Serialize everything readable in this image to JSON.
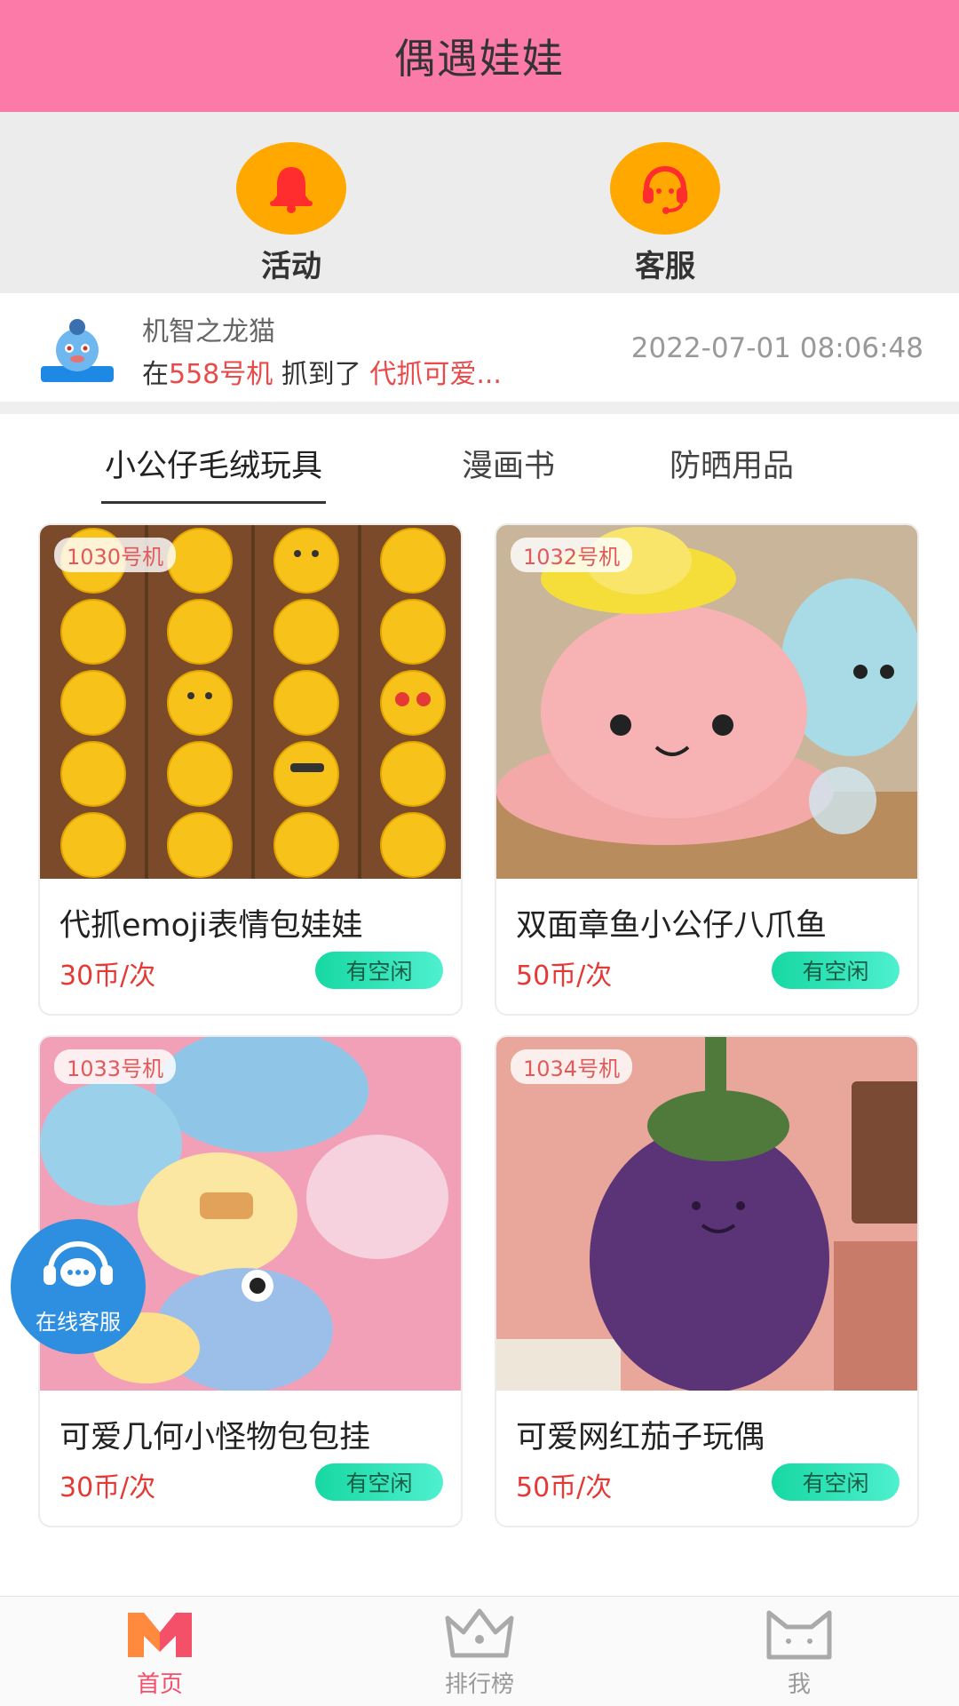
{
  "header": {
    "title": "偶遇娃娃"
  },
  "quick_actions": [
    {
      "label": "活动",
      "icon": "bell-icon"
    },
    {
      "label": "客服",
      "icon": "headset-icon"
    }
  ],
  "notice": {
    "nickname": "机智之龙猫",
    "prefix": "在",
    "machine": "558号机",
    "middle": " 抓到了 ",
    "prize": "代抓可爱...",
    "time": "2022-07-01 08:06:48"
  },
  "tabs": [
    "小公仔毛绒玩具",
    "漫画书",
    "防晒用品"
  ],
  "products": [
    {
      "tag": "1030号机",
      "name": "代抓emoji表情包娃娃",
      "price": "30币/次",
      "status": "有空闲"
    },
    {
      "tag": "1032号机",
      "name": "双面章鱼小公仔八爪鱼",
      "price": "50币/次",
      "status": "有空闲"
    },
    {
      "tag": "1033号机",
      "name": "可爱几何小怪物包包挂",
      "price": "30币/次",
      "status": "有空闲"
    },
    {
      "tag": "1034号机",
      "name": "可爱网红茄子玩偶",
      "price": "50币/次",
      "status": "有空闲"
    }
  ],
  "float_service": {
    "label": "在线客服"
  },
  "bottom_nav": [
    {
      "label": "首页",
      "active": true
    },
    {
      "label": "排行榜",
      "active": false
    },
    {
      "label": "我",
      "active": false
    }
  ],
  "colors": {
    "header": "#fb7aa8",
    "accent_orange": "#ffa800",
    "price_red": "#e53935",
    "status_green": "#17d8a2"
  }
}
